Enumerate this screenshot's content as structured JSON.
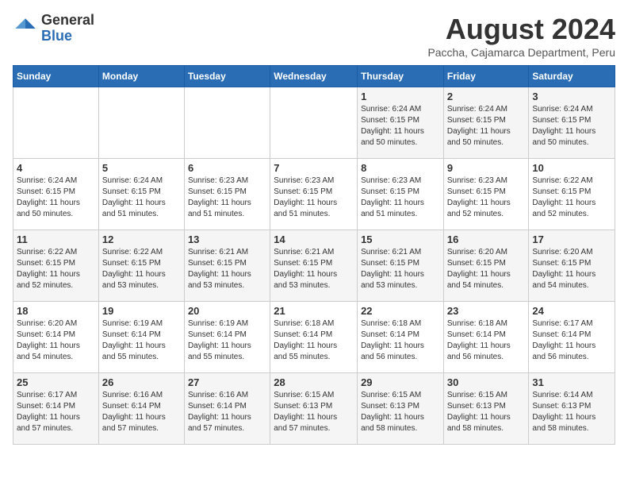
{
  "header": {
    "logo_general": "General",
    "logo_blue": "Blue",
    "month_year": "August 2024",
    "location": "Paccha, Cajamarca Department, Peru"
  },
  "calendar": {
    "days_of_week": [
      "Sunday",
      "Monday",
      "Tuesday",
      "Wednesday",
      "Thursday",
      "Friday",
      "Saturday"
    ],
    "weeks": [
      [
        {
          "day": "",
          "info": ""
        },
        {
          "day": "",
          "info": ""
        },
        {
          "day": "",
          "info": ""
        },
        {
          "day": "",
          "info": ""
        },
        {
          "day": "1",
          "info": "Sunrise: 6:24 AM\nSunset: 6:15 PM\nDaylight: 11 hours\nand 50 minutes."
        },
        {
          "day": "2",
          "info": "Sunrise: 6:24 AM\nSunset: 6:15 PM\nDaylight: 11 hours\nand 50 minutes."
        },
        {
          "day": "3",
          "info": "Sunrise: 6:24 AM\nSunset: 6:15 PM\nDaylight: 11 hours\nand 50 minutes."
        }
      ],
      [
        {
          "day": "4",
          "info": "Sunrise: 6:24 AM\nSunset: 6:15 PM\nDaylight: 11 hours\nand 50 minutes."
        },
        {
          "day": "5",
          "info": "Sunrise: 6:24 AM\nSunset: 6:15 PM\nDaylight: 11 hours\nand 51 minutes."
        },
        {
          "day": "6",
          "info": "Sunrise: 6:23 AM\nSunset: 6:15 PM\nDaylight: 11 hours\nand 51 minutes."
        },
        {
          "day": "7",
          "info": "Sunrise: 6:23 AM\nSunset: 6:15 PM\nDaylight: 11 hours\nand 51 minutes."
        },
        {
          "day": "8",
          "info": "Sunrise: 6:23 AM\nSunset: 6:15 PM\nDaylight: 11 hours\nand 51 minutes."
        },
        {
          "day": "9",
          "info": "Sunrise: 6:23 AM\nSunset: 6:15 PM\nDaylight: 11 hours\nand 52 minutes."
        },
        {
          "day": "10",
          "info": "Sunrise: 6:22 AM\nSunset: 6:15 PM\nDaylight: 11 hours\nand 52 minutes."
        }
      ],
      [
        {
          "day": "11",
          "info": "Sunrise: 6:22 AM\nSunset: 6:15 PM\nDaylight: 11 hours\nand 52 minutes."
        },
        {
          "day": "12",
          "info": "Sunrise: 6:22 AM\nSunset: 6:15 PM\nDaylight: 11 hours\nand 53 minutes."
        },
        {
          "day": "13",
          "info": "Sunrise: 6:21 AM\nSunset: 6:15 PM\nDaylight: 11 hours\nand 53 minutes."
        },
        {
          "day": "14",
          "info": "Sunrise: 6:21 AM\nSunset: 6:15 PM\nDaylight: 11 hours\nand 53 minutes."
        },
        {
          "day": "15",
          "info": "Sunrise: 6:21 AM\nSunset: 6:15 PM\nDaylight: 11 hours\nand 53 minutes."
        },
        {
          "day": "16",
          "info": "Sunrise: 6:20 AM\nSunset: 6:15 PM\nDaylight: 11 hours\nand 54 minutes."
        },
        {
          "day": "17",
          "info": "Sunrise: 6:20 AM\nSunset: 6:15 PM\nDaylight: 11 hours\nand 54 minutes."
        }
      ],
      [
        {
          "day": "18",
          "info": "Sunrise: 6:20 AM\nSunset: 6:14 PM\nDaylight: 11 hours\nand 54 minutes."
        },
        {
          "day": "19",
          "info": "Sunrise: 6:19 AM\nSunset: 6:14 PM\nDaylight: 11 hours\nand 55 minutes."
        },
        {
          "day": "20",
          "info": "Sunrise: 6:19 AM\nSunset: 6:14 PM\nDaylight: 11 hours\nand 55 minutes."
        },
        {
          "day": "21",
          "info": "Sunrise: 6:18 AM\nSunset: 6:14 PM\nDaylight: 11 hours\nand 55 minutes."
        },
        {
          "day": "22",
          "info": "Sunrise: 6:18 AM\nSunset: 6:14 PM\nDaylight: 11 hours\nand 56 minutes."
        },
        {
          "day": "23",
          "info": "Sunrise: 6:18 AM\nSunset: 6:14 PM\nDaylight: 11 hours\nand 56 minutes."
        },
        {
          "day": "24",
          "info": "Sunrise: 6:17 AM\nSunset: 6:14 PM\nDaylight: 11 hours\nand 56 minutes."
        }
      ],
      [
        {
          "day": "25",
          "info": "Sunrise: 6:17 AM\nSunset: 6:14 PM\nDaylight: 11 hours\nand 57 minutes."
        },
        {
          "day": "26",
          "info": "Sunrise: 6:16 AM\nSunset: 6:14 PM\nDaylight: 11 hours\nand 57 minutes."
        },
        {
          "day": "27",
          "info": "Sunrise: 6:16 AM\nSunset: 6:14 PM\nDaylight: 11 hours\nand 57 minutes."
        },
        {
          "day": "28",
          "info": "Sunrise: 6:15 AM\nSunset: 6:13 PM\nDaylight: 11 hours\nand 57 minutes."
        },
        {
          "day": "29",
          "info": "Sunrise: 6:15 AM\nSunset: 6:13 PM\nDaylight: 11 hours\nand 58 minutes."
        },
        {
          "day": "30",
          "info": "Sunrise: 6:15 AM\nSunset: 6:13 PM\nDaylight: 11 hours\nand 58 minutes."
        },
        {
          "day": "31",
          "info": "Sunrise: 6:14 AM\nSunset: 6:13 PM\nDaylight: 11 hours\nand 58 minutes."
        }
      ]
    ]
  }
}
